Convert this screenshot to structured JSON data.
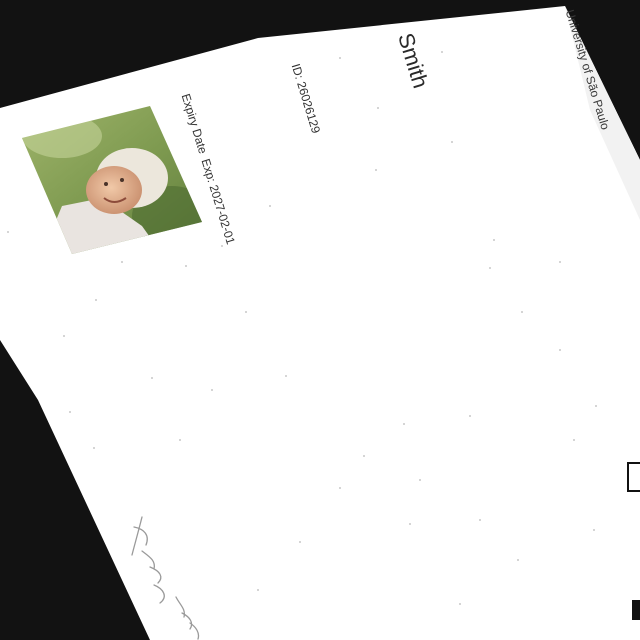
{
  "card": {
    "university": "University of São Paulo",
    "surname": "Smith",
    "id_label": "ID:",
    "id_value": "26026129",
    "expiry_label": "Expiry Date",
    "expiry_value": "Exp: 2027-02-01",
    "photo_icon": "portrait-photo",
    "signature_icon": "handwritten-signature",
    "colors": {
      "background": "#121212",
      "paper": "#ffffff",
      "text": "#2b2b2b"
    }
  }
}
